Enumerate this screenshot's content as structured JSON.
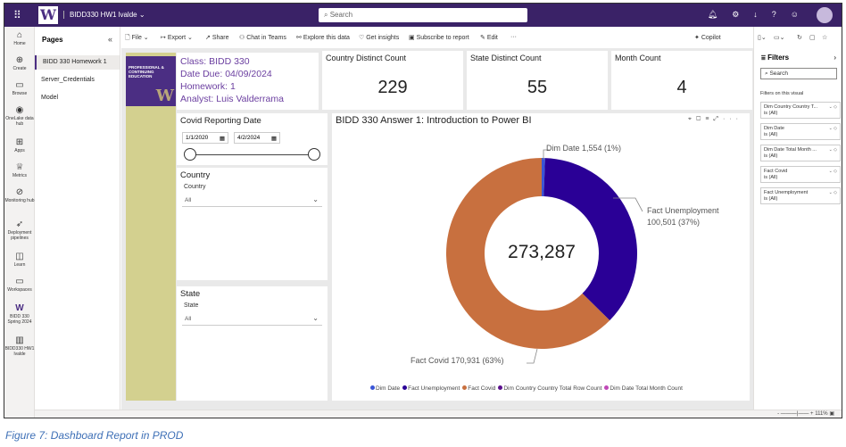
{
  "header": {
    "workspace_name": "BIDD330 HW1 lvalde",
    "search_placeholder": "Search"
  },
  "left_nav": [
    {
      "label": "Home",
      "icon": "home-icon"
    },
    {
      "label": "Create",
      "icon": "plus-icon"
    },
    {
      "label": "Browse",
      "icon": "folder-icon"
    },
    {
      "label": "OneLake data hub",
      "icon": "onelake-icon"
    },
    {
      "label": "Apps",
      "icon": "apps-icon"
    },
    {
      "label": "Metrics",
      "icon": "trophy-icon"
    },
    {
      "label": "Monitoring hub",
      "icon": "monitor-icon"
    },
    {
      "label": "Deployment pipelines",
      "icon": "rocket-icon"
    },
    {
      "label": "Learn",
      "icon": "book-icon"
    },
    {
      "label": "Workspaces",
      "icon": "workspaces-icon"
    },
    {
      "label": "BIDD 330 Spring 2024",
      "icon": "uw-logo-icon"
    },
    {
      "label": "BIDD330 HW1 lvalde",
      "icon": "report-icon"
    }
  ],
  "pages_panel": {
    "title": "Pages",
    "items": [
      "BIDD 330 Homework 1",
      "Server_Credentials",
      "Model"
    ]
  },
  "command_bar": {
    "file": "File",
    "export": "Export",
    "share": "Share",
    "chat": "Chat in Teams",
    "explore": "Explore this data",
    "insights": "Get insights",
    "subscribe": "Subscribe to report",
    "edit": "Edit",
    "copilot": "Copilot"
  },
  "banner": {
    "org_text": "PROFESSIONAL & CONTINUING EDUCATION",
    "logo_letter": "W"
  },
  "info": {
    "class": "Class: BIDD 330",
    "due": "Date Due: 04/09/2024",
    "homework": "Homework: 1",
    "analyst": "Analyst: Luis Valderrama"
  },
  "kpis": [
    {
      "title": "Country Distinct Count",
      "value": "229"
    },
    {
      "title": "State Distinct Count",
      "value": "55"
    },
    {
      "title": "Month Count",
      "value": "4"
    }
  ],
  "date_slicer": {
    "title": "Covid Reporting Date",
    "start": "1/1/2020",
    "end": "4/2/2024"
  },
  "country_slicer": {
    "title": "Country",
    "field": "Country",
    "value": "All"
  },
  "state_slicer": {
    "title": "State",
    "field": "State",
    "value": "All"
  },
  "chart_data": {
    "type": "pie",
    "title": "BIDD 330 Answer 1: Introduction to Power BI",
    "center_value": "273,287",
    "slices": [
      {
        "name": "Dim Date",
        "value": 1554,
        "pct": "1%",
        "label": "Dim Date 1,554 (1%)",
        "color": "#3a55d6"
      },
      {
        "name": "Fact Unemployment",
        "value": 100501,
        "pct": "37%",
        "label_line1": "Fact Unemployment",
        "label_line2": "100,501 (37%)",
        "color": "#2a0096"
      },
      {
        "name": "Fact Covid",
        "value": 170931,
        "pct": "63%",
        "label": "Fact Covid 170,931 (63%)",
        "color": "#c8703f"
      }
    ],
    "legend": [
      {
        "name": "Dim Date",
        "color": "#3a55d6"
      },
      {
        "name": "Fact Unemployment",
        "color": "#2a0096"
      },
      {
        "name": "Fact Covid",
        "color": "#c8703f"
      },
      {
        "name": "Dim Country Country Total Row Count",
        "color": "#5b0f8c"
      },
      {
        "name": "Dim Date Total Month Count",
        "color": "#c049b7"
      }
    ]
  },
  "filters_pane": {
    "title": "Filters",
    "search_placeholder": "Search",
    "section": "Filters on this visual",
    "cards": [
      {
        "name": "Dim Country Country T...",
        "value": "is (All)"
      },
      {
        "name": "Dim Date",
        "value": "is (All)"
      },
      {
        "name": "Dim Date Total Month ...",
        "value": "is (All)"
      },
      {
        "name": "Fact Covid",
        "value": "is (All)"
      },
      {
        "name": "Fact Unemployment",
        "value": "is (All)"
      }
    ]
  },
  "zoom": "111%",
  "caption": "Figure 7: Dashboard Report in PROD"
}
